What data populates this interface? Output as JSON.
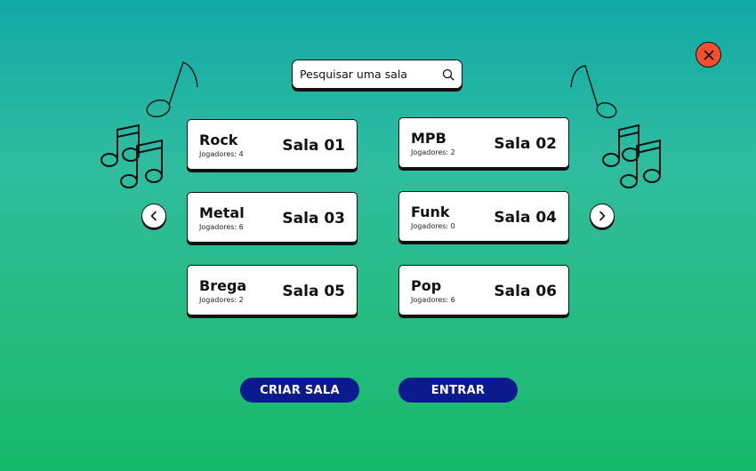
{
  "search": {
    "placeholder": "Pesquisar uma sala"
  },
  "rooms": [
    {
      "genre": "Rock",
      "players": "Jogadores: 4",
      "room": "Sala 01"
    },
    {
      "genre": "MPB",
      "players": "Jogadores: 2",
      "room": "Sala 02"
    },
    {
      "genre": "Metal",
      "players": "Jogadores: 6",
      "room": "Sala 03"
    },
    {
      "genre": "Funk",
      "players": "Jogadores: 0",
      "room": "Sala 04"
    },
    {
      "genre": "Brega",
      "players": "Jogadores: 2",
      "room": "Sala 05"
    },
    {
      "genre": "Pop",
      "players": "Jogadores: 6",
      "room": "Sala 06"
    }
  ],
  "actions": {
    "create": "CRIAR SALA",
    "enter": "ENTRAR"
  },
  "icons": {
    "close": "close-icon",
    "search": "search-icon",
    "prev": "chevron-left-icon",
    "next": "chevron-right-icon",
    "decor": "music-note-icon"
  },
  "colors": {
    "close": "#f2502e",
    "button": "#0b1a8c",
    "background_top": "#12a8a6",
    "background_bottom": "#15b86a"
  }
}
